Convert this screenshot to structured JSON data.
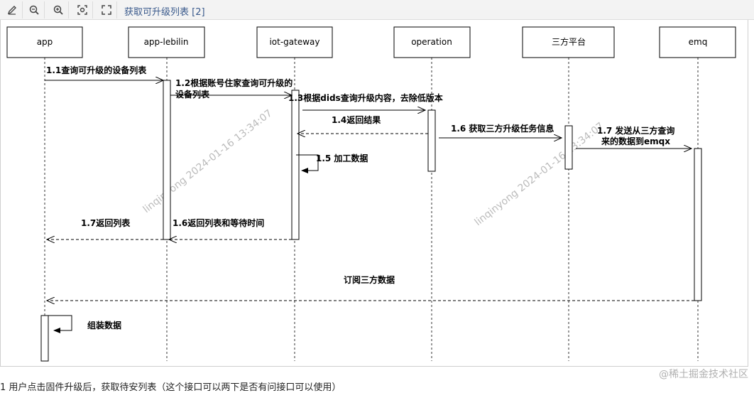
{
  "toolbar": {
    "title": "获取可升级列表 [2]",
    "buttons": [
      "edit-icon",
      "zoom-out-icon",
      "zoom-in-icon",
      "fit-view-icon",
      "fullscreen-icon"
    ]
  },
  "actors": [
    "app",
    "app-lebilin",
    "iot-gateway",
    "operation",
    "三方平台",
    "emq"
  ],
  "messages": {
    "m11": "1.1查询可升级的设备列表",
    "m12_line1": "1.2根据账号住家查询可升级的",
    "m12_line2": "设备列表",
    "m13": "1.3根据dids查询升级内容，去除低版本",
    "m14": "1.4返回结果",
    "m15": "1.5 加工数据",
    "m16a": "1.6 获取三方升级任务信息",
    "m17a_line1": "1.7 发送从三方查询",
    "m17a_line2": "来的数据到emqx",
    "m16b": "1.6返回列表和等待时间",
    "m17b": "1.7返回列表",
    "subscribe": "订阅三方数据",
    "assemble": "组装数据"
  },
  "watermarks": [
    "linqinyong 2024-01-16 13:34:07",
    "linqinyong 2024-01-16 13:34:07"
  ],
  "footer": {
    "text": "1 用户点击固件升级后，获取待安列表（这个接口可以两下是否有问接口可以使用）",
    "brand": "@稀土掘金技术社区"
  },
  "colors": {
    "toolbar_title": "#3a5a8c",
    "watermark": "#bbbbbb",
    "line": "#000000"
  }
}
